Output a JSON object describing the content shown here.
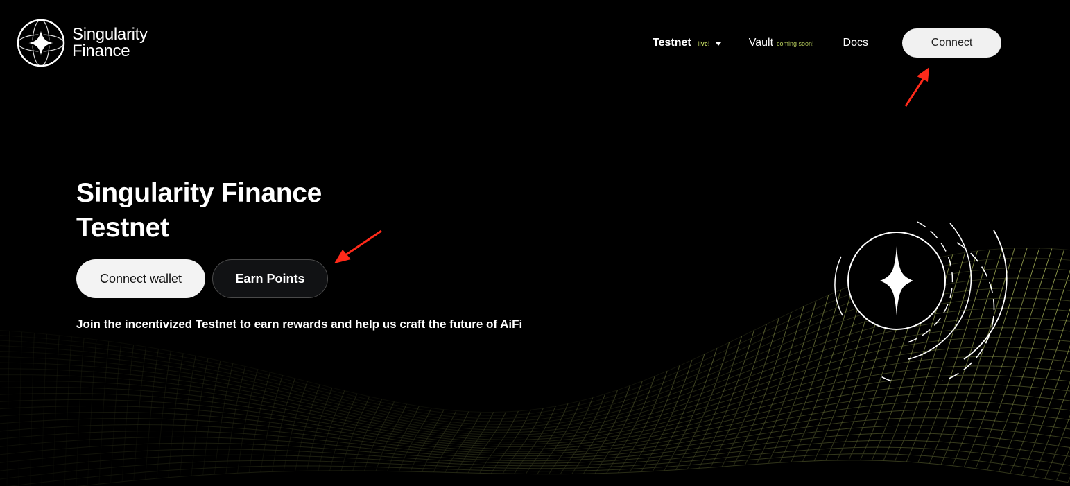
{
  "brand": {
    "name_line1": "Singularity",
    "name_line2": "Finance"
  },
  "nav": {
    "testnet_label": "Testnet",
    "testnet_badge": "live!",
    "vault_label": "Vault",
    "vault_badge": "coming soon!",
    "docs_label": "Docs",
    "connect_label": "Connect"
  },
  "hero": {
    "title_line1": "Singularity Finance",
    "title_line2": "Testnet",
    "connect_wallet_label": "Connect wallet",
    "earn_points_label": "Earn Points",
    "tagline": "Join the incentivized Testnet to earn rewards and help us craft the future of AiFi"
  },
  "colors": {
    "background": "#000000",
    "accent_green": "#b6cc5c",
    "wave": "#c9d86a",
    "annotation_arrow": "#ff2a1a",
    "button_light": "#f1f1f1",
    "button_dark": "#111214"
  },
  "icons": {
    "logo": "four-point-star-globe-icon",
    "caret": "caret-down-icon",
    "emblem": "four-point-star-orbit-icon"
  }
}
